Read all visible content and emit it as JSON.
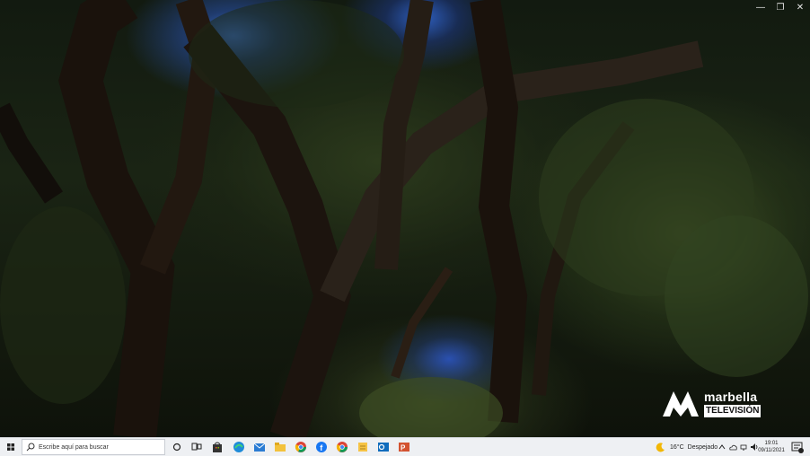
{
  "window": {
    "minimize_glyph": "—",
    "restore_glyph": "❐",
    "close_glyph": "✕"
  },
  "video": {
    "logo_brand": "marbella",
    "logo_sub": "TELEVISIÓN"
  },
  "taskbar": {
    "search_placeholder": "Escribe aquí para buscar",
    "pinned_icons": [
      "cortana-circle-icon",
      "task-view-icon",
      "store-icon",
      "edge-icon",
      "mail-icon",
      "file-explorer-icon",
      "chrome-icon",
      "facebook-icon",
      "chrome-icon",
      "notes-icon",
      "outlook-icon",
      "powerpoint-icon"
    ],
    "weather_temp": "16°C",
    "weather_desc": "Despejado",
    "time": "19:01",
    "date": "09/11/2021"
  },
  "colors": {
    "accent": "#3b7ed8",
    "taskbar_bg": "#eef0f3"
  }
}
